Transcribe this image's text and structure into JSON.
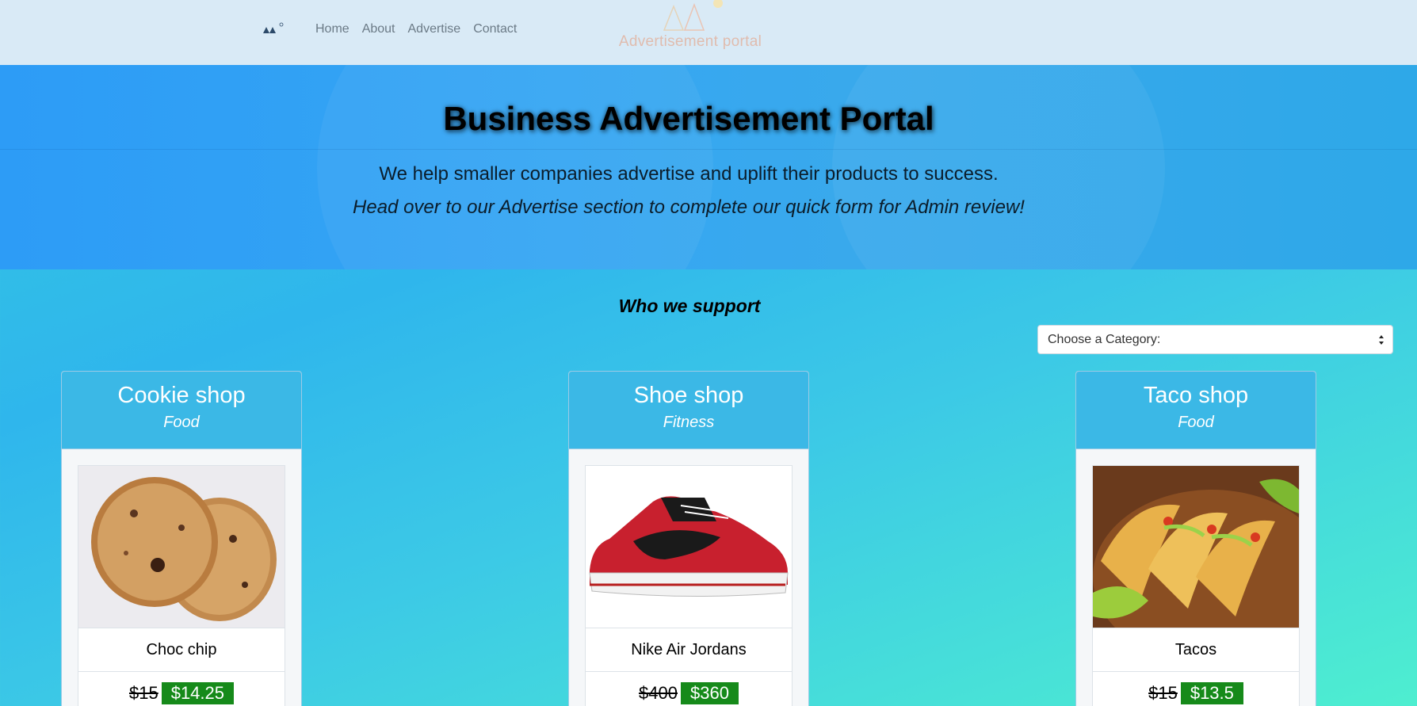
{
  "nav": {
    "brand_text": "Advertisement portal",
    "links": [
      "Home",
      "About",
      "Advertise",
      "Contact"
    ],
    "center_logo_text": "Advertisement portal"
  },
  "hero": {
    "title": "Business Advertisement Portal",
    "subtitle": "We help smaller companies advertise and uplift their products to success.",
    "note": "Head over to our Advertise section to complete our quick form for Admin review!"
  },
  "support": {
    "title": "Who we support",
    "category_select": {
      "selected": "Choose a Category:"
    }
  },
  "cards": [
    {
      "shop": "Cookie shop",
      "category": "Food",
      "product": "Choc chip",
      "old_price": "$15",
      "new_price": "$14.25",
      "image": "cookies-photo"
    },
    {
      "shop": "Shoe shop",
      "category": "Fitness",
      "product": "Nike Air Jordans",
      "old_price": "$400",
      "new_price": "$360",
      "image": "sneaker-photo"
    },
    {
      "shop": "Taco shop",
      "category": "Food",
      "product": "Tacos",
      "old_price": "$15",
      "new_price": "$13.5",
      "image": "tacos-photo"
    }
  ],
  "colors": {
    "navbar": "#d9eaf6",
    "hero": "#35a6f3",
    "card_header": "#3bb8e6",
    "sale_badge": "#168a1a"
  }
}
